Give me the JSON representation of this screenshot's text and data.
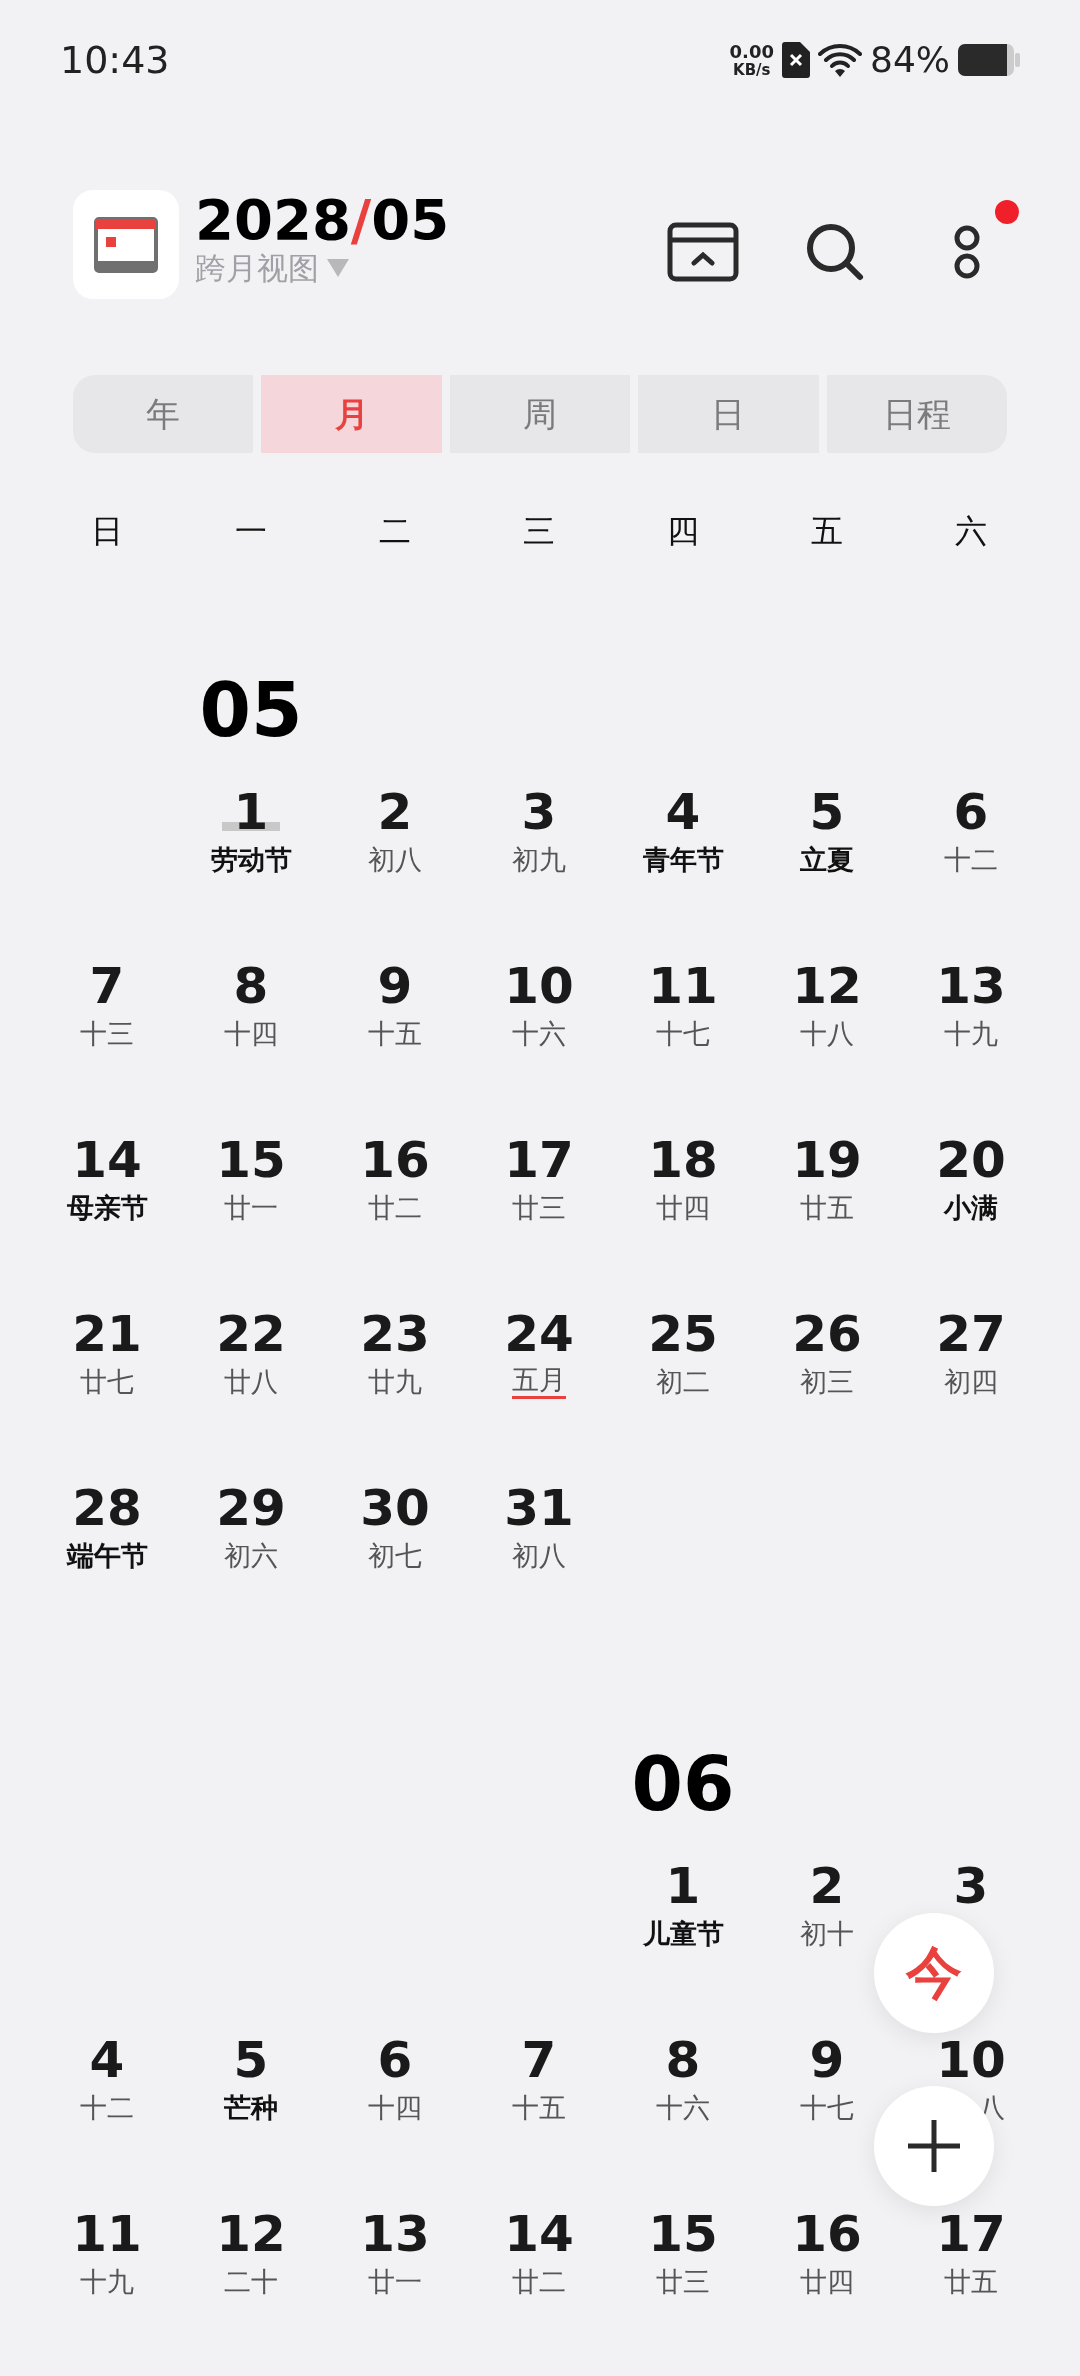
{
  "status_bar": {
    "time": "10:43",
    "speed_value": "0.00",
    "speed_unit": "KB/s",
    "battery": "84%"
  },
  "header": {
    "year": "2028",
    "separator": "/",
    "month": "05",
    "view": "跨月视图",
    "notification": true
  },
  "tabs": [
    {
      "label": "年",
      "selected": false
    },
    {
      "label": "月",
      "selected": true
    },
    {
      "label": "周",
      "selected": false
    },
    {
      "label": "日",
      "selected": false
    },
    {
      "label": "日程",
      "selected": false
    }
  ],
  "weekdays": [
    "日",
    "一",
    "二",
    "三",
    "四",
    "五",
    "六"
  ],
  "months": [
    {
      "label": "05",
      "weeks": [
        [
          {
            "kind": "empty"
          },
          {
            "kind": "day",
            "day": "1",
            "sub": {
              "text": "劳动节",
              "kind": "festival"
            },
            "selected": true
          },
          {
            "kind": "day",
            "day": "2",
            "sub": {
              "text": "初八",
              "kind": "lunar"
            },
            "selected": false
          },
          {
            "kind": "day",
            "day": "3",
            "sub": {
              "text": "初九",
              "kind": "lunar"
            },
            "selected": false
          },
          {
            "kind": "day",
            "day": "4",
            "sub": {
              "text": "青年节",
              "kind": "festival"
            },
            "selected": false
          },
          {
            "kind": "day",
            "day": "5",
            "sub": {
              "text": "立夏",
              "kind": "festival"
            },
            "selected": false
          },
          {
            "kind": "day",
            "day": "6",
            "sub": {
              "text": "十二",
              "kind": "lunar"
            },
            "selected": false
          }
        ],
        [
          {
            "kind": "day",
            "day": "7",
            "sub": {
              "text": "十三",
              "kind": "lunar"
            },
            "selected": false
          },
          {
            "kind": "day",
            "day": "8",
            "sub": {
              "text": "十四",
              "kind": "lunar"
            },
            "selected": false
          },
          {
            "kind": "day",
            "day": "9",
            "sub": {
              "text": "十五",
              "kind": "lunar"
            },
            "selected": false
          },
          {
            "kind": "day",
            "day": "10",
            "sub": {
              "text": "十六",
              "kind": "lunar"
            },
            "selected": false
          },
          {
            "kind": "day",
            "day": "11",
            "sub": {
              "text": "十七",
              "kind": "lunar"
            },
            "selected": false
          },
          {
            "kind": "day",
            "day": "12",
            "sub": {
              "text": "十八",
              "kind": "lunar"
            },
            "selected": false
          },
          {
            "kind": "day",
            "day": "13",
            "sub": {
              "text": "十九",
              "kind": "lunar"
            },
            "selected": false
          }
        ],
        [
          {
            "kind": "day",
            "day": "14",
            "sub": {
              "text": "母亲节",
              "kind": "festival"
            },
            "selected": false
          },
          {
            "kind": "day",
            "day": "15",
            "sub": {
              "text": "廿一",
              "kind": "lunar"
            },
            "selected": false
          },
          {
            "kind": "day",
            "day": "16",
            "sub": {
              "text": "廿二",
              "kind": "lunar"
            },
            "selected": false
          },
          {
            "kind": "day",
            "day": "17",
            "sub": {
              "text": "廿三",
              "kind": "lunar"
            },
            "selected": false
          },
          {
            "kind": "day",
            "day": "18",
            "sub": {
              "text": "廿四",
              "kind": "lunar"
            },
            "selected": false
          },
          {
            "kind": "day",
            "day": "19",
            "sub": {
              "text": "廿五",
              "kind": "lunar"
            },
            "selected": false
          },
          {
            "kind": "day",
            "day": "20",
            "sub": {
              "text": "小满",
              "kind": "festival"
            },
            "selected": false
          }
        ],
        [
          {
            "kind": "day",
            "day": "21",
            "sub": {
              "text": "廿七",
              "kind": "lunar"
            },
            "selected": false
          },
          {
            "kind": "day",
            "day": "22",
            "sub": {
              "text": "廿八",
              "kind": "lunar"
            },
            "selected": false
          },
          {
            "kind": "day",
            "day": "23",
            "sub": {
              "text": "廿九",
              "kind": "lunar"
            },
            "selected": false
          },
          {
            "kind": "day",
            "day": "24",
            "sub": {
              "text": "五月",
              "kind": "month-start"
            },
            "selected": false
          },
          {
            "kind": "day",
            "day": "25",
            "sub": {
              "text": "初二",
              "kind": "lunar"
            },
            "selected": false
          },
          {
            "kind": "day",
            "day": "26",
            "sub": {
              "text": "初三",
              "kind": "lunar"
            },
            "selected": false
          },
          {
            "kind": "day",
            "day": "27",
            "sub": {
              "text": "初四",
              "kind": "lunar"
            },
            "selected": false
          }
        ],
        [
          {
            "kind": "day",
            "day": "28",
            "sub": {
              "text": "端午节",
              "kind": "festival"
            },
            "selected": false
          },
          {
            "kind": "day",
            "day": "29",
            "sub": {
              "text": "初六",
              "kind": "lunar"
            },
            "selected": false
          },
          {
            "kind": "day",
            "day": "30",
            "sub": {
              "text": "初七",
              "kind": "lunar"
            },
            "selected": false
          },
          {
            "kind": "day",
            "day": "31",
            "sub": {
              "text": "初八",
              "kind": "lunar"
            },
            "selected": false
          }
        ]
      ]
    },
    {
      "label": "06",
      "weeks": [
        [
          {
            "kind": "empty"
          },
          {
            "kind": "empty"
          },
          {
            "kind": "empty"
          },
          {
            "kind": "empty"
          },
          {
            "kind": "day",
            "day": "1",
            "sub": {
              "text": "儿童节",
              "kind": "festival"
            },
            "selected": false
          },
          {
            "kind": "day",
            "day": "2",
            "sub": {
              "text": "初十",
              "kind": "lunar"
            },
            "selected": false
          },
          {
            "kind": "day",
            "day": "3",
            "selected": false
          }
        ],
        [
          {
            "kind": "day",
            "day": "4",
            "sub": {
              "text": "十二",
              "kind": "lunar"
            },
            "selected": false
          },
          {
            "kind": "day",
            "day": "5",
            "sub": {
              "text": "芒种",
              "kind": "festival"
            },
            "selected": false
          },
          {
            "kind": "day",
            "day": "6",
            "sub": {
              "text": "十四",
              "kind": "lunar"
            },
            "selected": false
          },
          {
            "kind": "day",
            "day": "7",
            "sub": {
              "text": "十五",
              "kind": "lunar"
            },
            "selected": false
          },
          {
            "kind": "day",
            "day": "8",
            "sub": {
              "text": "十六",
              "kind": "lunar"
            },
            "selected": false
          },
          {
            "kind": "day",
            "day": "9",
            "sub": {
              "text": "十七",
              "kind": "lunar"
            },
            "selected": false
          },
          {
            "kind": "day",
            "day": "10",
            "sub": {
              "text": "八",
              "kind": "cut"
            },
            "selected": false
          }
        ],
        [
          {
            "kind": "day",
            "day": "11",
            "sub": {
              "text": "十九",
              "kind": "lunar"
            },
            "selected": false
          },
          {
            "kind": "day",
            "day": "12",
            "sub": {
              "text": "二十",
              "kind": "lunar"
            },
            "selected": false
          },
          {
            "kind": "day",
            "day": "13",
            "sub": {
              "text": "廿一",
              "kind": "lunar"
            },
            "selected": false
          },
          {
            "kind": "day",
            "day": "14",
            "sub": {
              "text": "廿二",
              "kind": "lunar"
            },
            "selected": false
          },
          {
            "kind": "day",
            "day": "15",
            "sub": {
              "text": "廿三",
              "kind": "lunar"
            },
            "selected": false
          },
          {
            "kind": "day",
            "day": "16",
            "sub": {
              "text": "廿四",
              "kind": "lunar"
            },
            "selected": false
          },
          {
            "kind": "day",
            "day": "17",
            "sub": {
              "text": "廿五",
              "kind": "lunar"
            },
            "selected": false
          }
        ]
      ]
    }
  ],
  "fab_today": "今"
}
